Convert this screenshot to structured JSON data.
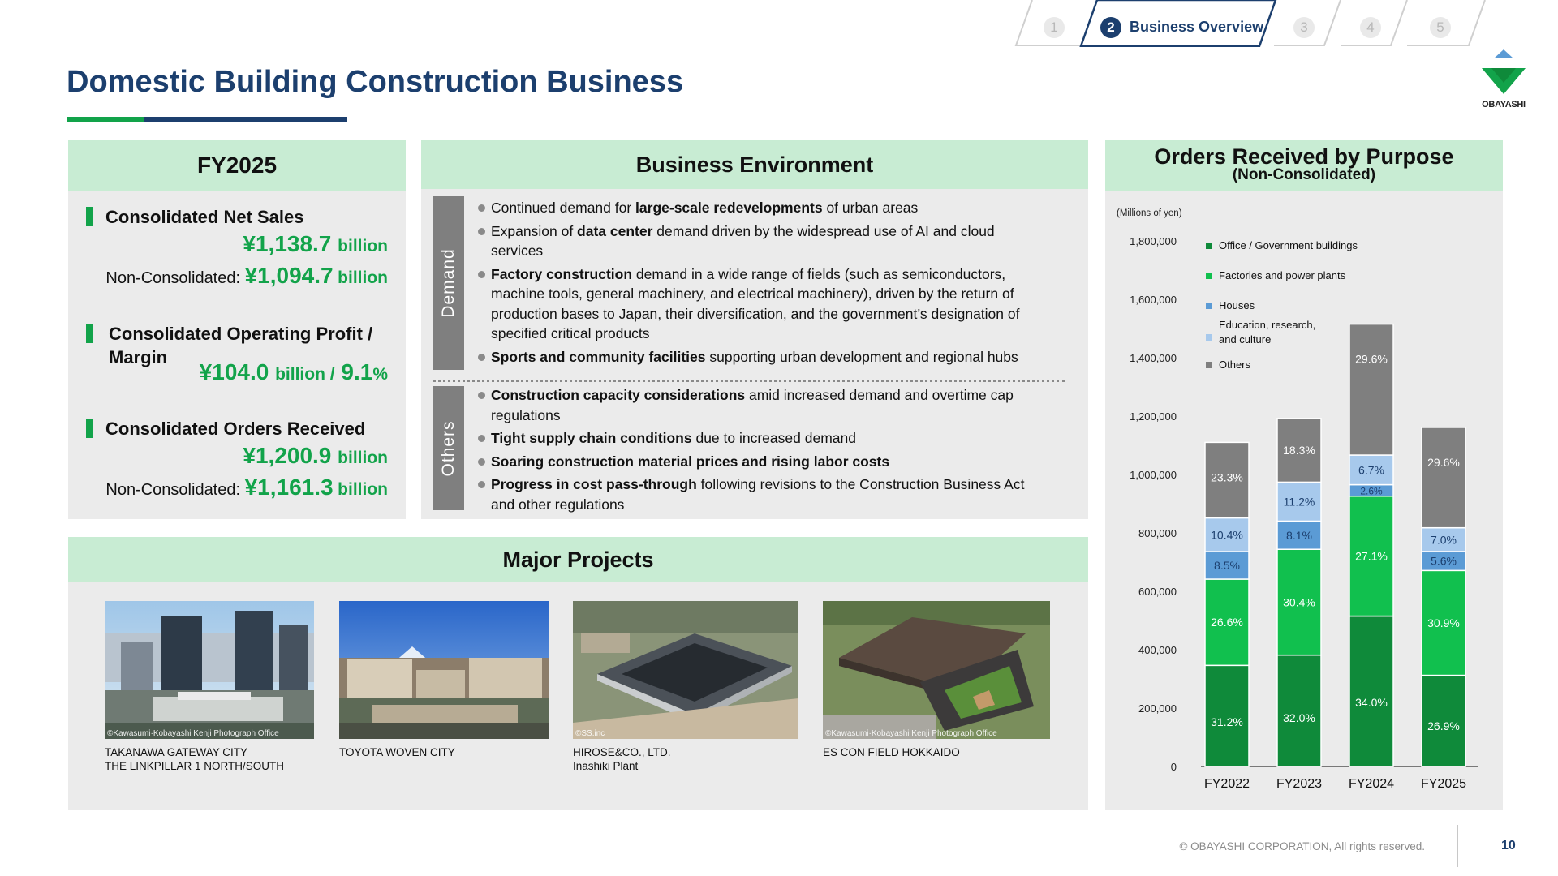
{
  "nav": {
    "tabs": [
      {
        "num": "1",
        "label": "",
        "active": false
      },
      {
        "num": "2",
        "label": "Business Overview",
        "active": true
      },
      {
        "num": "3",
        "label": "",
        "active": false
      },
      {
        "num": "4",
        "label": "",
        "active": false
      },
      {
        "num": "5",
        "label": "",
        "active": false
      }
    ]
  },
  "logo": {
    "text": "OBAYASHI"
  },
  "page": {
    "title": "Domestic Building Construction Business"
  },
  "fy": {
    "header": "FY2025",
    "net_sales_label": "Consolidated Net Sales",
    "net_sales_value": "¥1,138.7",
    "net_sales_unit": "billion",
    "non_consol_prefix": "Non-Consolidated:",
    "net_sales_nc_value": "¥1,094.7",
    "net_sales_nc_unit": "billion",
    "op_label_line1": "Consolidated Operating Profit /",
    "op_label_line2": "Margin",
    "op_value": "¥104.0",
    "op_unit": "billion /",
    "margin_value": "9.1",
    "margin_unit": "%",
    "orders_label": "Consolidated Orders Received",
    "orders_value": "¥1,200.9",
    "orders_unit": "billion",
    "orders_nc_value": "¥1,161.3",
    "orders_nc_unit": "billion"
  },
  "env": {
    "header": "Business Environment",
    "demand_label": "Demand",
    "others_label": "Others",
    "demand_items": [
      {
        "pre": "Continued demand for ",
        "bold": "large-scale redevelopments",
        "post": " of urban areas"
      },
      {
        "pre": "Expansion of ",
        "bold": "data center",
        "post": " demand driven by the widespread use of AI and cloud services"
      },
      {
        "pre": "",
        "bold": "Factory construction",
        "post": " demand in a wide range of fields (such as semiconductors, machine tools, general machinery, and electrical machinery), driven by the return of production bases to Japan, their diversification, and the government’s designation of specified critical products"
      },
      {
        "pre": "",
        "bold": "Sports and community facilities",
        "post": " supporting urban development and regional hubs"
      }
    ],
    "others_items": [
      {
        "pre": "",
        "bold": "Construction capacity considerations",
        "post": " amid increased demand  and overtime cap regulations"
      },
      {
        "pre": "",
        "bold": "Tight supply chain conditions",
        "post": " due to increased demand"
      },
      {
        "pre": "",
        "bold": "Soaring construction material prices and rising labor costs",
        "post": ""
      },
      {
        "pre": "",
        "bold": "Progress in cost pass-through",
        "post": " following revisions to the Construction Business Act and other regulations"
      }
    ]
  },
  "projects": {
    "header": "Major Projects",
    "items": [
      {
        "caption_line1": "TAKANAWA GATEWAY CITY",
        "caption_line2": "THE LINKPILLAR 1 NORTH/SOUTH",
        "credit": "©Kawasumi·Kobayashi Kenji Photograph Office"
      },
      {
        "caption_line1": "TOYOTA WOVEN CITY",
        "caption_line2": "",
        "credit": ""
      },
      {
        "caption_line1": "HIROSE&CO., LTD.",
        "caption_line2": "Inashiki Plant",
        "credit": "©SS.inc"
      },
      {
        "caption_line1": "ES CON FIELD HOKKAIDO",
        "caption_line2": "",
        "credit": "©Kawasumi·Kobayashi Kenji Photograph Office"
      }
    ]
  },
  "chart_data": {
    "type": "bar",
    "stacked": true,
    "title": "Orders Received by Purpose",
    "subtitle": "(Non-Consolidated)",
    "unit_label": "(Millions of yen)",
    "categories": [
      "FY2022",
      "FY2023",
      "FY2024",
      "FY2025"
    ],
    "totals": [
      1110000,
      1192000,
      1515000,
      1161300
    ],
    "ylim": [
      0,
      1800000
    ],
    "yticks": [
      0,
      200000,
      400000,
      600000,
      800000,
      1000000,
      1200000,
      1400000,
      1600000,
      1800000
    ],
    "ytick_labels": [
      "0",
      "200,000",
      "400,000",
      "600,000",
      "800,000",
      "1,000,000",
      "1,200,000",
      "1,400,000",
      "1,600,000",
      "1,800,000"
    ],
    "grid": false,
    "legend_position": "top-left",
    "series": [
      {
        "name": "Office / Government buildings",
        "color": "#0f8a3a",
        "percent": [
          31.2,
          32.0,
          34.0,
          26.9
        ],
        "labels": [
          "31.2%",
          "32.0%",
          "34.0%",
          "26.9%"
        ]
      },
      {
        "name": "Factories and power plants",
        "color": "#11c04e",
        "percent": [
          26.6,
          30.4,
          27.1,
          30.9
        ],
        "labels": [
          "26.6%",
          "30.4%",
          "27.1%",
          "30.9%"
        ]
      },
      {
        "name": "Houses",
        "color": "#5b9bd5",
        "percent": [
          8.5,
          8.1,
          2.6,
          5.6
        ],
        "labels": [
          "8.5%",
          "8.1%",
          "2.6%",
          "5.6%"
        ]
      },
      {
        "name": "Education, research, and culture",
        "legend_line1": "Education, research,",
        "legend_line2": "and culture",
        "color": "#a7c9ec",
        "percent": [
          10.4,
          11.2,
          6.7,
          7.0
        ],
        "labels": [
          "10.4%",
          "11.2%",
          "6.7%",
          "7.0%"
        ]
      },
      {
        "name": "Others",
        "color": "#7f7f7f",
        "percent": [
          23.3,
          18.3,
          29.6,
          29.6
        ],
        "labels": [
          "23.3%",
          "18.3%",
          "29.6%",
          "29.6%"
        ]
      }
    ]
  },
  "footer": {
    "copyright": "© OBAYASHI CORPORATION, All rights reserved.",
    "page_number": "10"
  },
  "colors": {
    "brand_blue": "#1c3f6e",
    "brand_green": "#12a34a",
    "panel_header": "#c8ecd3",
    "panel_bg": "#ebebeb"
  }
}
